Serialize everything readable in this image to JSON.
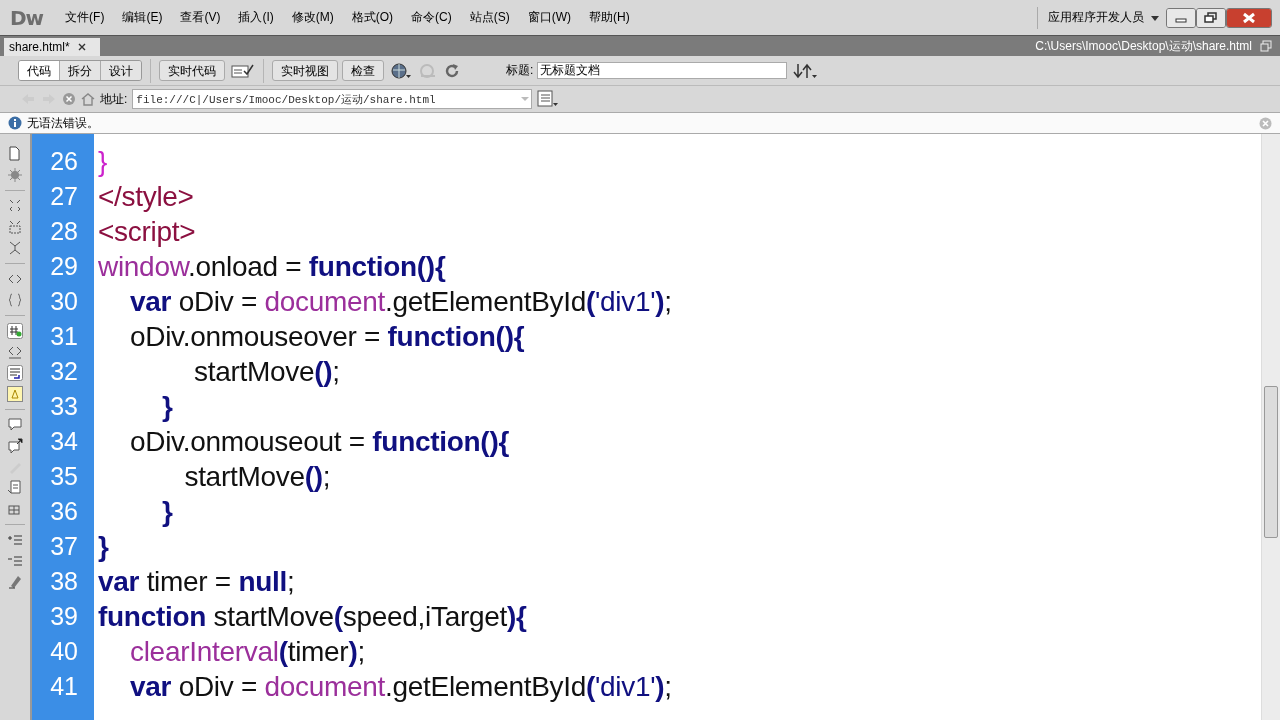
{
  "app": {
    "logo": "Dw",
    "menu": [
      "文件(F)",
      "编辑(E)",
      "查看(V)",
      "插入(I)",
      "修改(M)",
      "格式(O)",
      "命令(C)",
      "站点(S)",
      "窗口(W)",
      "帮助(H)"
    ],
    "workspace": "应用程序开发人员"
  },
  "document_tabs": [
    {
      "label": "share.html*",
      "selected": true
    }
  ],
  "file_path": "C:\\Users\\Imooc\\Desktop\\运动\\share.html",
  "toolbar": {
    "view_buttons": [
      {
        "label": "代码",
        "selected": true
      },
      {
        "label": "拆分",
        "selected": false
      },
      {
        "label": "设计",
        "selected": false
      }
    ],
    "live_code": "实时代码",
    "live_view": "实时视图",
    "inspect": "检查",
    "title_label": "标题:",
    "title_value": "无标题文档"
  },
  "address_bar": {
    "label": "地址:",
    "value": "file:///C|/Users/Imooc/Desktop/运动/share.html"
  },
  "info_bar": {
    "message": "无语法错误。"
  },
  "code_lines": [
    {
      "number": "26",
      "tokens": [
        {
          "kind": "brace",
          "text": "}"
        }
      ]
    },
    {
      "number": "27",
      "tokens": [
        {
          "kind": "tag",
          "text": "</style>"
        }
      ]
    },
    {
      "number": "28",
      "tokens": [
        {
          "kind": "tag",
          "text": "<script>"
        }
      ]
    },
    {
      "number": "29",
      "tokens": [
        {
          "kind": "object",
          "text": "window"
        },
        {
          "kind": "plain",
          "text": ".onload = "
        },
        {
          "kind": "keyword",
          "text": "function"
        },
        {
          "kind": "punct",
          "text": "(){"
        }
      ]
    },
    {
      "number": "30",
      "tokens": [
        {
          "kind": "keyword",
          "text": "\tvar"
        },
        {
          "kind": "plain",
          "text": " oDiv = "
        },
        {
          "kind": "object",
          "text": "document"
        },
        {
          "kind": "plain",
          "text": ".getElementById"
        },
        {
          "kind": "punct",
          "text": "("
        },
        {
          "kind": "string",
          "text": "'div1'"
        },
        {
          "kind": "punct",
          "text": ")"
        },
        {
          "kind": "plain",
          "text": ";"
        }
      ]
    },
    {
      "number": "31",
      "tokens": [
        {
          "kind": "plain",
          "text": "\toDiv.onmouseover = "
        },
        {
          "kind": "keyword",
          "text": "function"
        },
        {
          "kind": "punct",
          "text": "(){"
        }
      ]
    },
    {
      "number": "32",
      "tokens": [
        {
          "kind": "plain",
          "text": "\t\t\tstartMove"
        },
        {
          "kind": "punct",
          "text": "()"
        },
        {
          "kind": "plain",
          "text": ";"
        }
      ]
    },
    {
      "number": "33",
      "tokens": [
        {
          "kind": "punct",
          "text": "\t\t}"
        }
      ]
    },
    {
      "number": "34",
      "tokens": [
        {
          "kind": "plain",
          "text": "\toDiv.onmouseout = "
        },
        {
          "kind": "keyword",
          "text": "function"
        },
        {
          "kind": "punct",
          "text": "(){"
        }
      ]
    },
    {
      "number": "35",
      "tokens": [
        {
          "kind": "plain",
          "text": "\t\t   startMove"
        },
        {
          "kind": "punct",
          "text": "()"
        },
        {
          "kind": "plain",
          "text": ";"
        }
      ]
    },
    {
      "number": "36",
      "tokens": [
        {
          "kind": "punct",
          "text": "\t\t}"
        }
      ]
    },
    {
      "number": "37",
      "tokens": [
        {
          "kind": "punct",
          "text": "}"
        }
      ]
    },
    {
      "number": "38",
      "tokens": [
        {
          "kind": "keyword",
          "text": "var"
        },
        {
          "kind": "plain",
          "text": " timer = "
        },
        {
          "kind": "keyword",
          "text": "null"
        },
        {
          "kind": "plain",
          "text": ";"
        }
      ]
    },
    {
      "number": "39",
      "tokens": [
        {
          "kind": "keyword",
          "text": "function"
        },
        {
          "kind": "plain",
          "text": " startMove"
        },
        {
          "kind": "punct",
          "text": "("
        },
        {
          "kind": "plain",
          "text": "speed,iTarget"
        },
        {
          "kind": "punct",
          "text": "){"
        }
      ]
    },
    {
      "number": "40",
      "tokens": [
        {
          "kind": "object",
          "text": "\tclearInterval"
        },
        {
          "kind": "punct",
          "text": "("
        },
        {
          "kind": "plain",
          "text": "timer"
        },
        {
          "kind": "punct",
          "text": ")"
        },
        {
          "kind": "plain",
          "text": ";"
        }
      ]
    },
    {
      "number": "41",
      "tokens": [
        {
          "kind": "keyword",
          "text": "\tvar"
        },
        {
          "kind": "plain",
          "text": " oDiv = "
        },
        {
          "kind": "object",
          "text": "document"
        },
        {
          "kind": "plain",
          "text": ".getElementById"
        },
        {
          "kind": "punct",
          "text": "("
        },
        {
          "kind": "string",
          "text": "'div1'"
        },
        {
          "kind": "punct",
          "text": ")"
        },
        {
          "kind": "plain",
          "text": ";"
        }
      ]
    }
  ]
}
